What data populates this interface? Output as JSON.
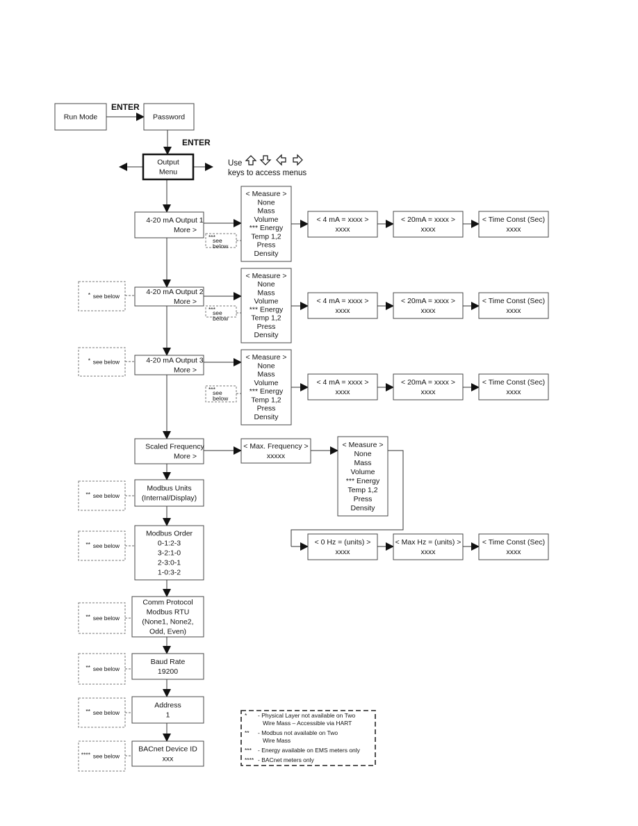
{
  "labels": {
    "enter_1": "ENTER",
    "enter_2": "ENTER",
    "use": "Use",
    "keys_text": "keys to access menus"
  },
  "icons": [
    "arrow-up-icon",
    "arrow-down-icon",
    "arrow-left-icon",
    "arrow-right-icon"
  ],
  "nodes": {
    "run_mode": [
      "Run Mode"
    ],
    "password": [
      "Password"
    ],
    "output_menu": [
      "Output",
      "Menu"
    ],
    "output1": [
      "4-20 mA Output 1",
      "More >"
    ],
    "output2": [
      "4-20 mA Output 2",
      "More >"
    ],
    "output3": [
      "4-20 mA Output 3",
      "More >"
    ],
    "scaled_frequency": [
      "Scaled Frequency",
      "More >"
    ],
    "modbus_units": [
      "Modbus Units",
      "(Internal/Display)"
    ],
    "modbus_order": [
      "Modbus Order",
      "0-1:2-3",
      "3-2:1-0",
      "2-3:0-1",
      "1-0:3-2"
    ],
    "comm_protocol": [
      "Comm Protocol",
      "Modbus RTU",
      "(None1, None2,",
      "Odd, Even)"
    ],
    "baud_rate": [
      "Baud Rate",
      "19200"
    ],
    "address": [
      "Address",
      "1"
    ],
    "bacnet": [
      "BACnet Device ID",
      "xxx"
    ],
    "measure1": [
      "< Measure >",
      "None",
      "Mass",
      "Volume",
      "*** Energy",
      "Temp 1,2",
      "Press",
      "Density"
    ],
    "measure2": [
      "< Measure >",
      "None",
      "Mass",
      "Volume",
      "*** Energy",
      "Temp 1,2",
      "Press",
      "Density"
    ],
    "measure3": [
      "< Measure >",
      "None",
      "Mass",
      "Volume",
      "*** Energy",
      "Temp 1,2",
      "Press",
      "Density"
    ],
    "measure4": [
      "< Measure >",
      "None",
      "Mass",
      "Volume",
      "*** Energy",
      "Temp 1,2",
      "Press",
      "Density"
    ],
    "ma4_1": [
      "< 4 mA = xxxx >",
      "xxxx"
    ],
    "ma20_1": [
      "< 20mA = xxxx >",
      "xxxx"
    ],
    "tc_1": [
      "< Time Const (Sec)",
      "xxxx"
    ],
    "ma4_2": [
      "< 4 mA = xxxx >",
      "xxxx"
    ],
    "ma20_2": [
      "< 20mA = xxxx >",
      "xxxx"
    ],
    "tc_2": [
      "< Time Const (Sec)",
      "xxxx"
    ],
    "ma4_3": [
      "< 4 mA = xxxx >",
      "xxxx"
    ],
    "ma20_3": [
      "< 20mA = xxxx >",
      "xxxx"
    ],
    "tc_3": [
      "< Time Const (Sec)",
      "xxxx"
    ],
    "max_freq": [
      "< Max. Frequency >",
      "xxxxx"
    ],
    "hz0": [
      "< 0 Hz = (units) >",
      "xxxx"
    ],
    "maxhz": [
      "< Max Hz = (units) >",
      "xxxx"
    ],
    "tc_4": [
      "< Time Const (Sec)",
      "xxxx"
    ]
  },
  "notes": {
    "sb1": [
      "***",
      "see",
      "below"
    ],
    "sb2": [
      "***",
      "see",
      "below"
    ],
    "sb3": [
      "***",
      "see",
      "below"
    ],
    "l_out2": [
      "*",
      "see below"
    ],
    "l_out3": [
      "*",
      "see below"
    ],
    "l_mu": [
      "**",
      "see below"
    ],
    "l_mo": [
      "**",
      "see below"
    ],
    "l_cp": [
      "**",
      "see below"
    ],
    "l_br": [
      "**",
      "see below"
    ],
    "l_ad": [
      "**",
      "see below"
    ],
    "l_bn": [
      "****",
      "see below"
    ]
  },
  "legend": [
    [
      "*",
      "- Physical Layer not available on Two",
      "Wire Mass – Accessible via HART"
    ],
    [
      "**",
      "- Modbus not available on Two",
      "Wire Mass"
    ],
    [
      "***",
      "- Energy available on EMS meters only"
    ],
    [
      "****",
      "- BACnet meters only"
    ]
  ]
}
